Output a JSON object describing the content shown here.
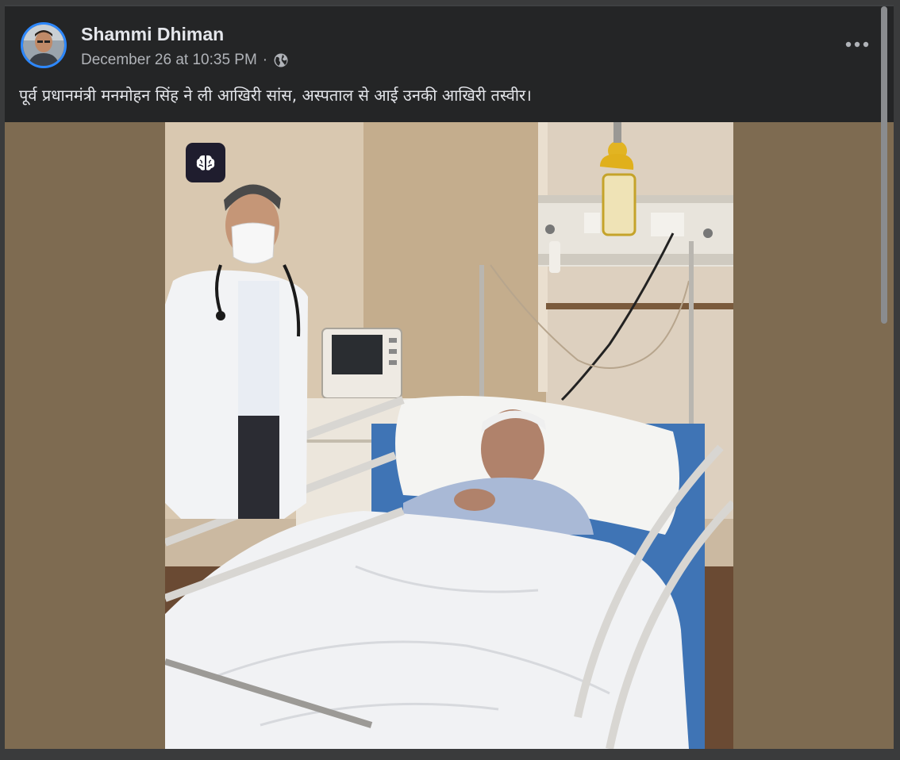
{
  "post": {
    "author": "Shammi Dhiman",
    "timestamp": "December 26 at 10:35 PM",
    "separator": "·",
    "audience_icon": "globe-icon",
    "caption": "पूर्व प्रधानमंत्री मनमोहन सिंह ने ली आखिरी सांस, अस्पताल से आई उनकी आखिरी तस्वीर।",
    "more_icon": "more-options-icon",
    "badge_icon": "ai-brain-icon"
  },
  "colors": {
    "page_bg": "#3a3b3c",
    "card_bg": "#242526",
    "text_primary": "#e4e6eb",
    "text_secondary": "#b0b3b8",
    "avatar_ring": "#2d88ff",
    "media_letterbox": "#7e6b51"
  }
}
